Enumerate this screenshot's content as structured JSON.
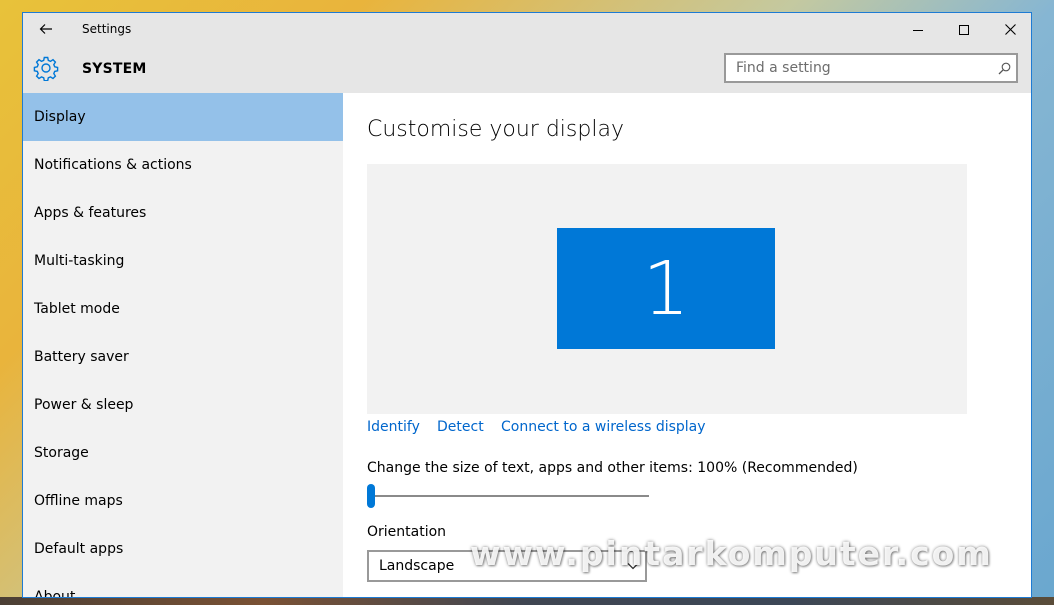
{
  "window": {
    "title": "Settings",
    "section_title": "SYSTEM",
    "accent_color": "#0078d7",
    "selection_color": "#94c1e9"
  },
  "search": {
    "placeholder": "Find a setting"
  },
  "sidebar": {
    "items": [
      {
        "label": "Display",
        "selected": true
      },
      {
        "label": "Notifications & actions"
      },
      {
        "label": "Apps & features"
      },
      {
        "label": "Multi-tasking"
      },
      {
        "label": "Tablet mode"
      },
      {
        "label": "Battery saver"
      },
      {
        "label": "Power & sleep"
      },
      {
        "label": "Storage"
      },
      {
        "label": "Offline maps"
      },
      {
        "label": "Default apps"
      },
      {
        "label": "About"
      }
    ]
  },
  "main": {
    "title": "Customise your display",
    "monitor_number": "1",
    "links": {
      "identify": "Identify",
      "detect": "Detect",
      "wireless": "Connect to a wireless display"
    },
    "scale_label": "Change the size of text, apps and other items: 100% (Recommended)",
    "scale_slider_fraction": 0,
    "orientation_label": "Orientation",
    "orientation_value": "Landscape"
  },
  "watermark": "www.pintarkomputer.com",
  "icons": {
    "back": "arrow-left-icon",
    "system": "gear-icon",
    "search": "magnifier-icon",
    "minimize": "minimize-icon",
    "maximize": "maximize-icon",
    "close": "close-icon",
    "dropdown": "chevron-down-icon"
  }
}
